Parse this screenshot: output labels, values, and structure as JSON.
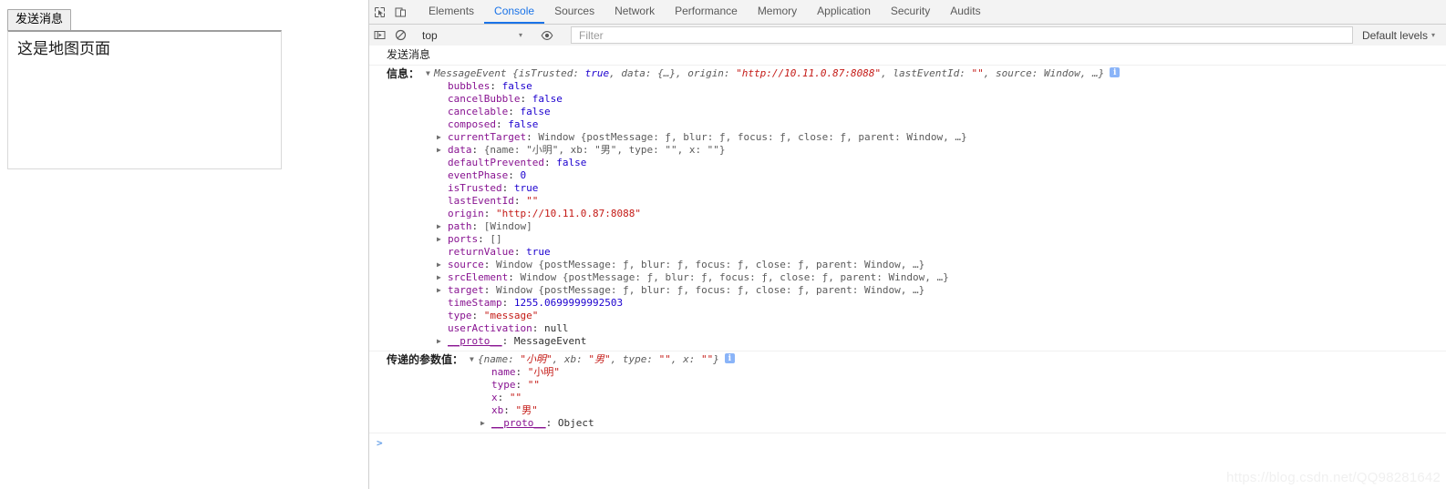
{
  "page": {
    "send_button_label": "发送消息",
    "iframe_text": "这是地图页面"
  },
  "devtools": {
    "toolbar_icons": [
      {
        "name": "inspect-element-icon"
      },
      {
        "name": "device-toolbar-icon"
      }
    ],
    "tabs": [
      {
        "label": "Elements",
        "active": false
      },
      {
        "label": "Console",
        "active": true
      },
      {
        "label": "Sources",
        "active": false
      },
      {
        "label": "Network",
        "active": false
      },
      {
        "label": "Performance",
        "active": false
      },
      {
        "label": "Memory",
        "active": false
      },
      {
        "label": "Application",
        "active": false
      },
      {
        "label": "Security",
        "active": false
      },
      {
        "label": "Audits",
        "active": false
      }
    ],
    "filterbar": {
      "sidebar_toggle_icon": "console-sidebar-icon",
      "clear_icon": "clear-console-icon",
      "context_value": "top",
      "context_arrow": "▾",
      "eye_icon": "live-expression-eye-icon",
      "filter_placeholder": "Filter",
      "levels_label": "Default levels",
      "levels_arrow": "▾"
    },
    "console": {
      "messages": [
        {
          "type": "plain",
          "text": "发送消息"
        },
        {
          "type": "object",
          "label": "信息：",
          "header": {
            "arrow": "▼",
            "classname": "MessageEvent",
            "preview_open": " {isTrusted: ",
            "preview": [
              {
                "t": "bool",
                "v": "true"
              },
              {
                "t": "plain",
                "v": ", data: "
              },
              {
                "t": "obj",
                "v": "{…}"
              },
              {
                "t": "plain",
                "v": ", origin: "
              },
              {
                "t": "str",
                "v": "\"http://10.11.0.87:8088\""
              },
              {
                "t": "plain",
                "v": ", lastEventId: "
              },
              {
                "t": "str",
                "v": "\"\""
              },
              {
                "t": "plain",
                "v": ", source: "
              },
              {
                "t": "obj",
                "v": "Window"
              },
              {
                "t": "plain",
                "v": ", …}"
              }
            ],
            "info_icon": "info-icon"
          },
          "properties": [
            {
              "expandable": false,
              "name": "bubbles",
              "value": "false",
              "vt": "bool"
            },
            {
              "expandable": false,
              "name": "cancelBubble",
              "value": "false",
              "vt": "bool"
            },
            {
              "expandable": false,
              "name": "cancelable",
              "value": "false",
              "vt": "bool"
            },
            {
              "expandable": false,
              "name": "composed",
              "value": "false",
              "vt": "bool"
            },
            {
              "expandable": true,
              "name": "currentTarget",
              "value": "Window {postMessage: ƒ, blur: ƒ, focus: ƒ, close: ƒ, parent: Window, …}",
              "vt": "window"
            },
            {
              "expandable": true,
              "name": "data",
              "value": "{name: \"小明\", xb: \"男\", type: \"\", x: \"\"}",
              "vt": "dataobj"
            },
            {
              "expandable": false,
              "name": "defaultPrevented",
              "value": "false",
              "vt": "bool"
            },
            {
              "expandable": false,
              "name": "eventPhase",
              "value": "0",
              "vt": "num"
            },
            {
              "expandable": false,
              "name": "isTrusted",
              "value": "true",
              "vt": "bool"
            },
            {
              "expandable": false,
              "name": "lastEventId",
              "value": "\"\"",
              "vt": "str"
            },
            {
              "expandable": false,
              "name": "origin",
              "value": "\"http://10.11.0.87:8088\"",
              "vt": "str"
            },
            {
              "expandable": true,
              "name": "path",
              "value": "[Window]",
              "vt": "obj"
            },
            {
              "expandable": true,
              "name": "ports",
              "value": "[]",
              "vt": "obj"
            },
            {
              "expandable": false,
              "name": "returnValue",
              "value": "true",
              "vt": "bool"
            },
            {
              "expandable": true,
              "name": "source",
              "value": "Window {postMessage: ƒ, blur: ƒ, focus: ƒ, close: ƒ, parent: Window, …}",
              "vt": "window"
            },
            {
              "expandable": true,
              "name": "srcElement",
              "value": "Window {postMessage: ƒ, blur: ƒ, focus: ƒ, close: ƒ, parent: Window, …}",
              "vt": "window"
            },
            {
              "expandable": true,
              "name": "target",
              "value": "Window {postMessage: ƒ, blur: ƒ, focus: ƒ, close: ƒ, parent: Window, …}",
              "vt": "window"
            },
            {
              "expandable": false,
              "name": "timeStamp",
              "value": "1255.0699999992503",
              "vt": "num"
            },
            {
              "expandable": false,
              "name": "type",
              "value": "\"message\"",
              "vt": "str"
            },
            {
              "expandable": false,
              "name": "userActivation",
              "value": "null",
              "vt": "null"
            },
            {
              "expandable": true,
              "name": "__proto__",
              "value": "MessageEvent",
              "vt": "obj",
              "proto": true
            }
          ]
        },
        {
          "type": "object",
          "label": "传递的参数值：",
          "header": {
            "arrow": "▼",
            "classname": "",
            "preview_open": "{name: ",
            "preview": [
              {
                "t": "str",
                "v": "\"小明\""
              },
              {
                "t": "plain",
                "v": ", xb: "
              },
              {
                "t": "str",
                "v": "\"男\""
              },
              {
                "t": "plain",
                "v": ", type: "
              },
              {
                "t": "str",
                "v": "\"\""
              },
              {
                "t": "plain",
                "v": ", x: "
              },
              {
                "t": "str",
                "v": "\"\""
              },
              {
                "t": "plain",
                "v": "}"
              }
            ],
            "info_icon": "info-icon"
          },
          "properties": [
            {
              "expandable": false,
              "name": "name",
              "value": "\"小明\"",
              "vt": "str"
            },
            {
              "expandable": false,
              "name": "type",
              "value": "\"\"",
              "vt": "str"
            },
            {
              "expandable": false,
              "name": "x",
              "value": "\"\"",
              "vt": "str"
            },
            {
              "expandable": false,
              "name": "xb",
              "value": "\"男\"",
              "vt": "str"
            },
            {
              "expandable": true,
              "name": "__proto__",
              "value": "Object",
              "vt": "obj",
              "proto": true
            }
          ]
        }
      ],
      "prompt_symbol": ">"
    }
  },
  "watermark": "https://blog.csdn.net/QQ98281642"
}
